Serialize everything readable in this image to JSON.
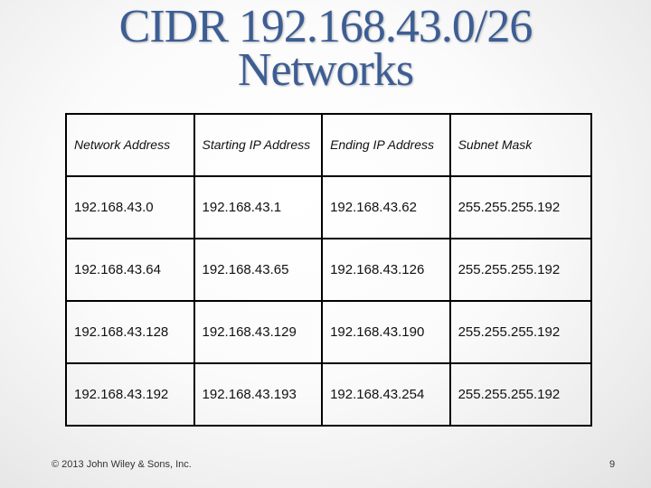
{
  "slide": {
    "title_line1": "CIDR 192.168.43.0/26",
    "title_line2": "Networks",
    "footer": "© 2013 John Wiley & Sons, Inc.",
    "page_number": "9"
  },
  "table": {
    "headers": [
      "Network Address",
      "Starting IP Address",
      "Ending IP Address",
      "Subnet Mask"
    ],
    "rows": [
      [
        "192.168.43.0",
        "192.168.43.1",
        "192.168.43.62",
        "255.255.255.192"
      ],
      [
        "192.168.43.64",
        "192.168.43.65",
        "192.168.43.126",
        "255.255.255.192"
      ],
      [
        "192.168.43.128",
        "192.168.43.129",
        "192.168.43.190",
        "255.255.255.192"
      ],
      [
        "192.168.43.192",
        "192.168.43.193",
        "192.168.43.254",
        "255.255.255.192"
      ]
    ]
  },
  "colors": {
    "title": "#3d5e94",
    "border": "#000000"
  }
}
